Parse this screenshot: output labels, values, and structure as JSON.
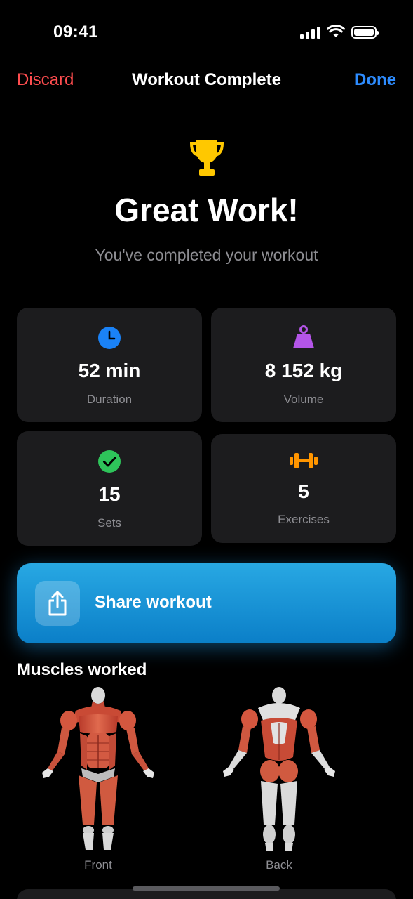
{
  "status_bar": {
    "time": "09:41"
  },
  "nav": {
    "discard_label": "Discard",
    "title": "Workout Complete",
    "done_label": "Done"
  },
  "hero": {
    "title": "Great Work!",
    "subtitle": "You've completed your workout"
  },
  "stats": [
    {
      "value": "52 min",
      "label": "Duration",
      "icon": "clock-icon",
      "color": "#1a82f7"
    },
    {
      "value": "8 152 kg",
      "label": "Volume",
      "icon": "weight-icon",
      "color": "#b455e8"
    },
    {
      "value": "15",
      "label": "Sets",
      "icon": "checkmark-circle-icon",
      "color": "#2ec45a"
    },
    {
      "value": "5",
      "label": "Exercises",
      "icon": "dumbbell-icon",
      "color": "#ff9500"
    }
  ],
  "share": {
    "label": "Share workout"
  },
  "muscles": {
    "title": "Muscles worked",
    "front_label": "Front",
    "back_label": "Back"
  },
  "colors": {
    "destructive": "#ff4d4f",
    "accent": "#2d8cff",
    "trophy": "#ffc800",
    "card": "#1c1c1e"
  }
}
